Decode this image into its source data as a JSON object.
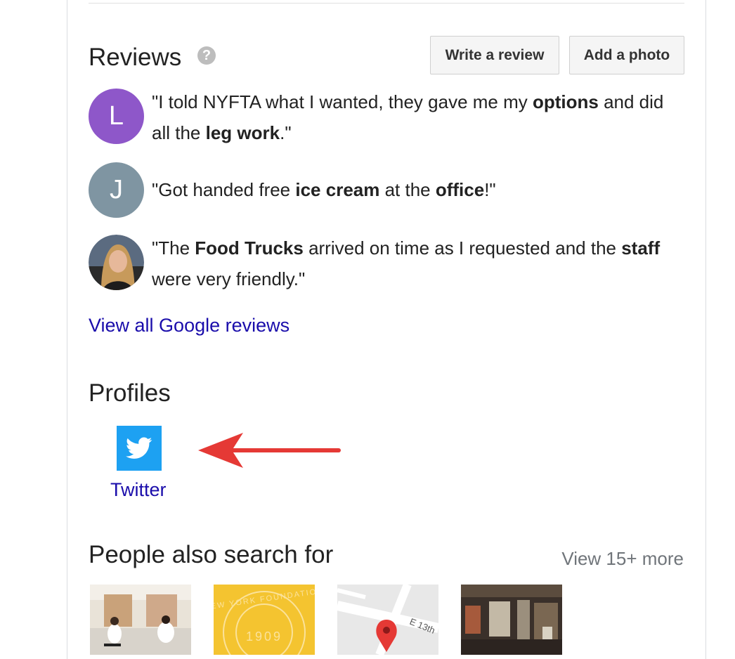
{
  "reviews": {
    "title": "Reviews",
    "help_icon": "help-circle-icon",
    "write_review_label": "Write a review",
    "add_photo_label": "Add a photo",
    "items": [
      {
        "avatar_letter": "L",
        "avatar_color": "#8e57c9",
        "parts": [
          "\"I told NYFTA what I wanted, they gave me my ",
          "options",
          " and did all the ",
          "leg work",
          ".\""
        ]
      },
      {
        "avatar_letter": "J",
        "avatar_color": "#7f95a2",
        "parts": [
          "\"Got handed free ",
          "ice cream",
          " at the ",
          "office",
          "!\""
        ]
      },
      {
        "avatar_letter": "",
        "avatar_color": "#4a4a4a",
        "parts": [
          "\"The ",
          "Food Trucks",
          " arrived on time as I requested and the ",
          "staff",
          " were very friendly.\""
        ]
      }
    ],
    "view_all_label": "View all Google reviews"
  },
  "profiles": {
    "title": "Profiles",
    "items": [
      {
        "label": "Twitter",
        "icon": "twitter-bird-icon",
        "color": "#1da1f2"
      }
    ],
    "annotation_arrow_color": "#e53935"
  },
  "people_also_search": {
    "title": "People also search for",
    "more_label": "View 15+ more",
    "thumbnails": [
      {
        "name": "studio-photo"
      },
      {
        "name": "new-york-foundation-logo",
        "badge_text": "NEW YORK FOUNDATION",
        "year": "1909",
        "color": "#f4c430"
      },
      {
        "name": "map-thumbnail",
        "street_label": "E 13th"
      },
      {
        "name": "store-interior-photo"
      }
    ]
  },
  "colors": {
    "link": "#1a0dab",
    "accent_twitter": "#1da1f2",
    "arrow": "#e53935"
  }
}
